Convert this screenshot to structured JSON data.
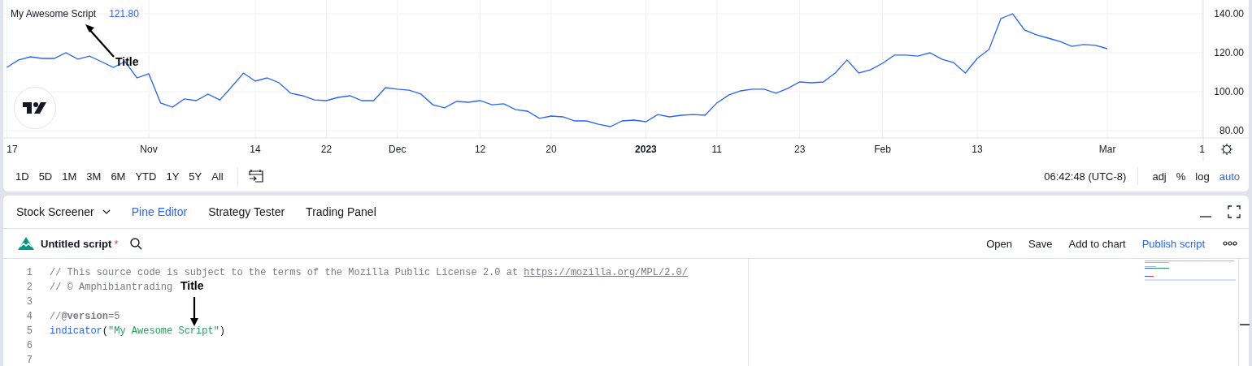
{
  "chart": {
    "legend": {
      "value": "121.80"
    },
    "chart_data": {
      "type": "line",
      "categories": [
        "17",
        null,
        null,
        null,
        null,
        null,
        null,
        null,
        null,
        null,
        null,
        null,
        "Nov",
        null,
        null,
        null,
        null,
        null,
        null,
        null,
        null,
        "14",
        null,
        null,
        null,
        null,
        null,
        "22",
        null,
        null,
        null,
        null,
        null,
        "Dec",
        null,
        null,
        null,
        null,
        null,
        null,
        "12",
        null,
        null,
        null,
        null,
        null,
        "20",
        null,
        null,
        null,
        null,
        null,
        null,
        null,
        "2023",
        null,
        null,
        null,
        null,
        null,
        "11",
        null,
        null,
        null,
        null,
        null,
        null,
        "23",
        null,
        null,
        null,
        null,
        null,
        null,
        "Feb",
        null,
        null,
        null,
        null,
        null,
        null,
        null,
        "13",
        null,
        null,
        null,
        null,
        null,
        null,
        null,
        null,
        null,
        null,
        "Mar",
        null,
        null,
        null,
        null,
        null,
        null,
        null,
        "1"
      ],
      "series": [
        {
          "name": "My Awesome Script",
          "color": "#2962ff",
          "values": [
            112.5,
            116.3,
            117.9,
            117.1,
            117.1,
            120,
            116.7,
            118.3,
            115.4,
            112.5,
            115.4,
            107.1,
            109.2,
            94.2,
            92.1,
            96.3,
            95.4,
            98.8,
            95.8,
            102.5,
            109.6,
            105.4,
            107.1,
            104.6,
            99.2,
            97.9,
            95.8,
            95.4,
            97.1,
            97.9,
            95.4,
            95.4,
            102.1,
            101.3,
            100.8,
            98.8,
            93.3,
            91.7,
            95,
            94.6,
            95.4,
            93.3,
            93.8,
            90.8,
            90,
            86.3,
            87.5,
            87.1,
            85,
            85,
            83.3,
            82.1,
            85,
            85.4,
            84.6,
            88.3,
            87.1,
            87.9,
            88.3,
            87.9,
            94.2,
            98.3,
            100.4,
            101.3,
            101.3,
            99.2,
            101.7,
            105,
            104.6,
            105,
            109.6,
            116.3,
            109.6,
            111.3,
            114.6,
            118.8,
            118.8,
            118.3,
            120,
            116.7,
            115,
            109.6,
            117.1,
            121.7,
            137.5,
            140,
            131.7,
            129.2,
            127.5,
            125.8,
            123.3,
            124.2,
            123.8,
            122.1,
            null,
            null,
            null,
            null,
            null,
            null,
            null,
            null
          ]
        }
      ],
      "grid": true,
      "ylim": [
        76.25,
        147.08
      ],
      "yticks": [
        {
          "value": 140,
          "label": "140.00"
        },
        {
          "value": 120,
          "label": "120.00"
        },
        {
          "value": 100,
          "label": "100.00"
        },
        {
          "value": 80,
          "label": "80.00"
        }
      ]
    }
  },
  "range_toolbar": {
    "ranges": [
      "1D",
      "5D",
      "1M",
      "3M",
      "6M",
      "YTD",
      "1Y",
      "5Y",
      "All"
    ],
    "clock": "06:42:48 (UTC-8)",
    "scale_options": [
      {
        "label": "adj",
        "on": false
      },
      {
        "label": "%",
        "on": false
      },
      {
        "label": "log",
        "on": false
      },
      {
        "label": "auto",
        "on": true
      }
    ]
  },
  "bottom_tabs": [
    {
      "label": "Stock Screener",
      "selected": false,
      "dropdown": true
    },
    {
      "label": "Pine Editor",
      "selected": true,
      "dropdown": false
    },
    {
      "label": "Strategy Tester",
      "selected": false,
      "dropdown": false
    },
    {
      "label": "Trading Panel",
      "selected": false,
      "dropdown": false
    }
  ],
  "script_toolbar": {
    "name": "Untitled script",
    "modified_mark": "*",
    "actions": [
      {
        "label": "Open",
        "highlighted": false
      },
      {
        "label": "Save",
        "highlighted": false
      },
      {
        "label": "Add to chart",
        "highlighted": false
      },
      {
        "label": "Publish script",
        "highlighted": true
      }
    ]
  },
  "editor": {
    "lines": [
      {
        "number": "1",
        "tokens": [
          {
            "kind": "comment",
            "text": "// This source code is subject to the terms of the Mozilla Public License 2.0 at "
          },
          {
            "kind": "link",
            "text": "https://mozilla.org/MPL/2.0/"
          }
        ]
      },
      {
        "number": "2",
        "tokens": [
          {
            "kind": "comment",
            "text": "// © Amphibiantrading"
          }
        ]
      },
      {
        "number": "3"
      },
      {
        "number": "4",
        "tokens": [
          {
            "kind": "comment",
            "text": "//"
          },
          {
            "kind": "directive",
            "text": "@version"
          },
          {
            "kind": "comment",
            "text": "=5"
          }
        ]
      },
      {
        "number": "5",
        "tokens": [
          {
            "kind": "function",
            "text": "indicator"
          },
          {
            "kind": "punct",
            "text": "("
          },
          {
            "kind": "string",
            "text": "\"My Awesome Script\""
          },
          {
            "kind": "punct",
            "text": ")"
          }
        ]
      },
      {
        "number": "6"
      },
      {
        "number": "7"
      }
    ]
  },
  "annotations": [
    {
      "text": "Title"
    },
    {
      "text": "Title"
    }
  ]
}
